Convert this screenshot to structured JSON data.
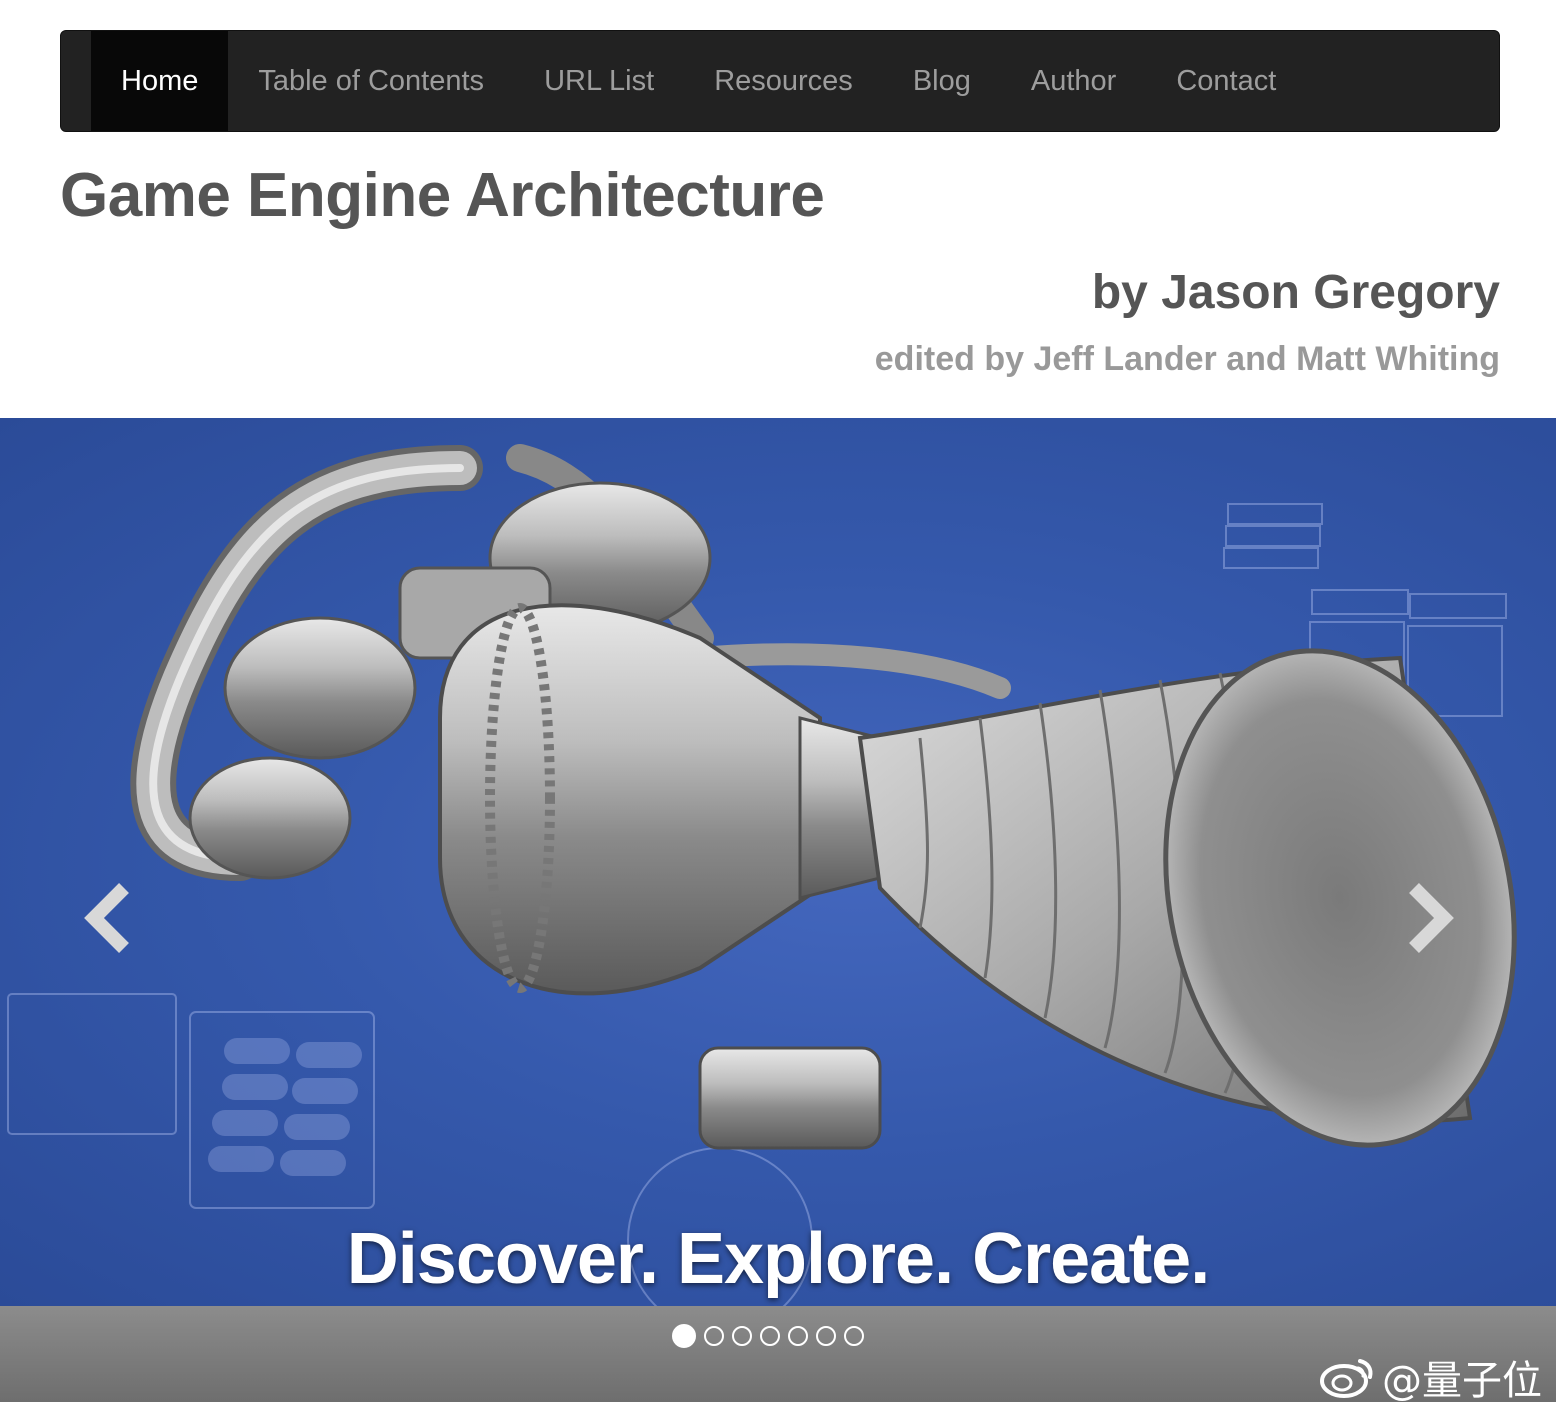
{
  "nav": {
    "items": [
      {
        "label": "Home",
        "active": true
      },
      {
        "label": "Table of Contents",
        "active": false
      },
      {
        "label": "URL List",
        "active": false
      },
      {
        "label": "Resources",
        "active": false
      },
      {
        "label": "Blog",
        "active": false
      },
      {
        "label": "Author",
        "active": false
      },
      {
        "label": "Contact",
        "active": false
      }
    ]
  },
  "header": {
    "title": "Game Engine Architecture",
    "author": "by Jason Gregory",
    "editors": "edited by Jeff Lander and Matt Whiting"
  },
  "carousel": {
    "caption": "Discover. Explore. Create.",
    "slide_count": 7,
    "active_index": 0,
    "prev_icon": "chevron-left-icon",
    "next_icon": "chevron-right-icon",
    "background_color": "#3559ac"
  },
  "watermark": {
    "text": "@量子位",
    "icon": "weibo-icon"
  }
}
